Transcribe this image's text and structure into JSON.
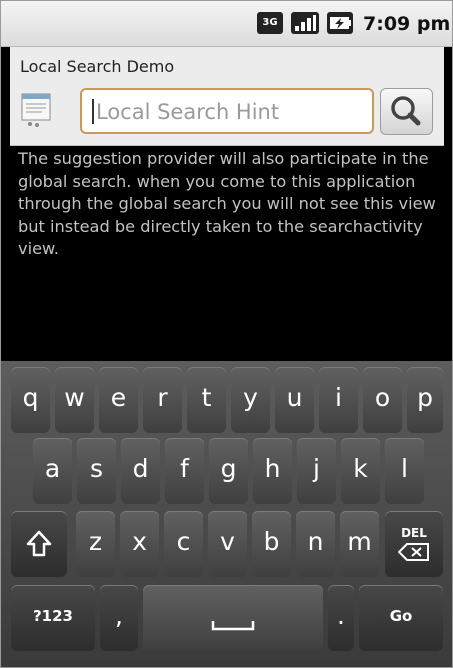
{
  "status_bar": {
    "network": "3G",
    "time": "7:09 pm"
  },
  "search": {
    "title": "Local Search Demo",
    "placeholder": "Local Search Hint",
    "button": "search"
  },
  "body_text": "The suggestion provider will also participate in the global search. when you come to this application through the global search you will not see this view but instead be directly taken to the searchactivity view.",
  "keyboard": {
    "row1": [
      "q",
      "w",
      "e",
      "r",
      "t",
      "y",
      "u",
      "i",
      "o",
      "p"
    ],
    "row2": [
      "a",
      "s",
      "d",
      "f",
      "g",
      "h",
      "j",
      "k",
      "l"
    ],
    "row3": [
      "z",
      "x",
      "c",
      "v",
      "b",
      "n",
      "m"
    ],
    "delete_label": "DEL",
    "symbols_label": "?123",
    "comma": ",",
    "period": ".",
    "go_label": "Go"
  }
}
